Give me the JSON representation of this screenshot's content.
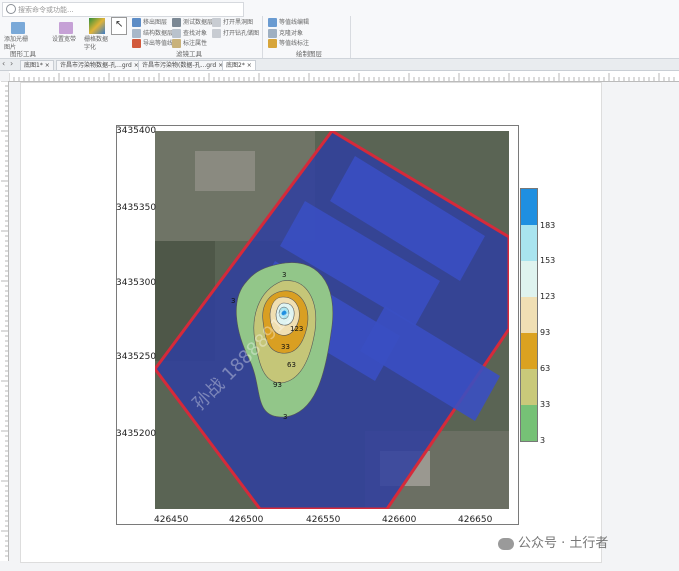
{
  "search": {
    "placeholder": "搜索命令或功能..."
  },
  "toolbar": {
    "left_buttons": [
      "添加光栅图片",
      "设置宽带"
    ],
    "raster_button": "栅格数据字化",
    "small_tools": [
      "移出图层",
      "结构数据层",
      "导出等值线",
      "测试数据层",
      "查找对象",
      "标注属性",
      "打开黑洞图",
      "打开钻孔储图",
      "等值线编辑",
      "克隆对象",
      "等值线标注"
    ],
    "group_labels": [
      "图形工具",
      "滤镜工具",
      "绘制图层"
    ]
  },
  "tabs": [
    "底图1*",
    "许昌市污染物数据-孔...grd",
    "许昌市污染物(数据-孔...grd",
    "底图2*"
  ],
  "active_tab_index": 3,
  "map": {
    "y_ticks": [
      "3435400",
      "3435350",
      "3435300",
      "3435250",
      "3435200"
    ],
    "x_ticks": [
      "426450",
      "426500",
      "426550",
      "426600",
      "426650"
    ],
    "contour_labels": [
      "3",
      "33",
      "63",
      "93",
      "123",
      "3",
      "3"
    ],
    "watermark_text": "孙战 18888915"
  },
  "legend": {
    "labels": [
      "183",
      "153",
      "123",
      "93",
      "63",
      "33",
      "3"
    ],
    "colors": [
      "#1f8fe0",
      "#a9e4ef",
      "#dff3ef",
      "#f0dfb4",
      "#dba220",
      "#c9c97a",
      "#76c176"
    ]
  },
  "watermark": {
    "text": "公众号 · 土行者"
  }
}
